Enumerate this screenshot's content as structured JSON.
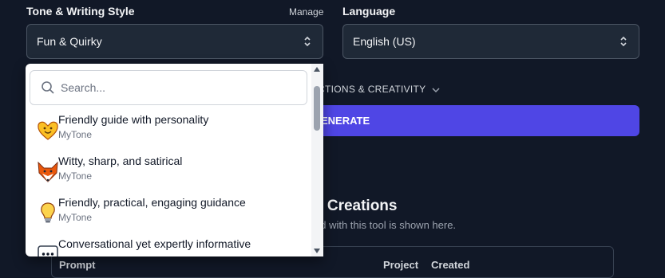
{
  "tone": {
    "label": "Tone & Writing Style",
    "manage": "Manage",
    "selected": "Fun & Quirky"
  },
  "language": {
    "label": "Language",
    "selected": "English (US)"
  },
  "advanced": {
    "label": "CTIONS & CREATIVITY"
  },
  "generate": {
    "label": "ENERATE"
  },
  "history": {
    "title": "s Creations",
    "subtitle": "ed with this tool is shown here.",
    "columns": [
      "Prompt",
      "Project",
      "Created"
    ]
  },
  "dropdown": {
    "search_placeholder": "Search...",
    "options": [
      {
        "title": "Friendly guide with personality",
        "source": "MyTone",
        "icon": "heart-face-icon"
      },
      {
        "title": "Witty, sharp, and satirical",
        "source": "MyTone",
        "icon": "fox-icon"
      },
      {
        "title": "Friendly, practical, engaging guidance",
        "source": "MyTone",
        "icon": "lightbulb-icon"
      },
      {
        "title": "Conversational yet expertly informative",
        "source": "",
        "icon": "speech-bubble-icon"
      }
    ]
  },
  "colors": {
    "background": "#111827",
    "field": "#1f2937",
    "accent": "#4f46e5"
  }
}
